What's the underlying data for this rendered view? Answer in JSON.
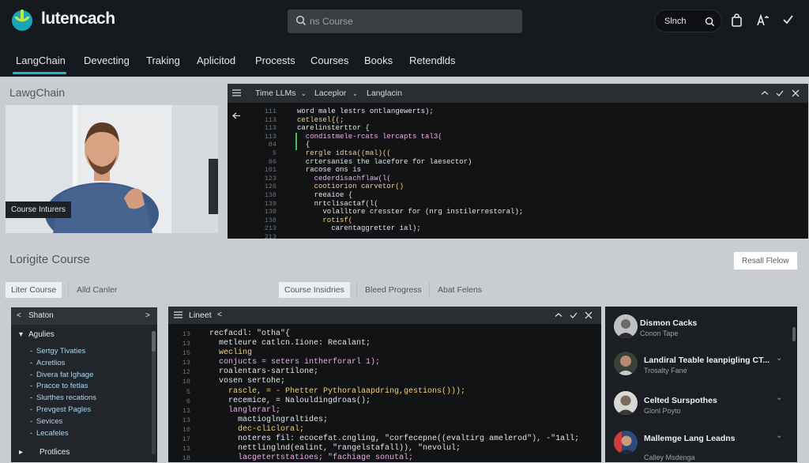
{
  "app": {
    "name": "lutencach"
  },
  "search": {
    "placeholder": "ns Course"
  },
  "header": {
    "signin_label": "Slnch"
  },
  "nav": {
    "items": [
      "LangChain",
      "Devecting",
      "Traking",
      "Aplicitod",
      "Procests",
      "Courses",
      "Books",
      "Retendlds"
    ],
    "active": 0
  },
  "hero": {
    "title": "LawgChain",
    "video_caption": "Course Inturers"
  },
  "editor1": {
    "tabs": [
      "Time LLMs",
      "Laceplor",
      "Langlacin"
    ],
    "line_numbers": [
      "111",
      "113",
      "113",
      "113",
      "84",
      "5",
      "86",
      "101",
      "123",
      "126",
      "138",
      "139",
      "130",
      "138",
      "213",
      "213"
    ],
    "lines": [
      "word male lestrs ontlangewerts);",
      "cetlesel{(;",
      "carelinsterttor {",
      "  condistmele-rcats lercapts tal3(",
      "  {",
      "  rergle idtsa((mal)((",
      "  crtersanies the lacefore for laesector)",
      "  racose ons is",
      "    cederdisachflaw(l(",
      "    cootiorion carvetor()",
      "    reeaioe {",
      "    nrtclisactaf(l(",
      "      volalltore cresster for (nrg instilerrestoral);",
      "      rotisf(",
      "        carentaggretter ial);"
    ]
  },
  "course": {
    "title": "Lorigite Course",
    "reset_label": "Resall Flelow"
  },
  "tabs_left": [
    "Liter Course",
    "Alld Canler"
  ],
  "tabs_right": [
    "Course Insidries",
    "Bleed Progress",
    "Abat Felens"
  ],
  "sidebar": {
    "header": "Shaton",
    "group1": "Agulies",
    "items": [
      "Sertgy Tivaties",
      "Acretlios",
      "Divera fat Ighage",
      "Pracce to fetlas",
      "Slurthes recations",
      "Prevgest Pagles",
      "Sevices",
      "Lecafeles"
    ],
    "group2": "Protlices"
  },
  "editor2": {
    "title": "Lineet",
    "line_numbers": [
      "13",
      "13",
      "15",
      "13",
      "12",
      "18",
      "5",
      "6",
      "13",
      "13",
      "10",
      "17",
      "13",
      "18"
    ],
    "lines": [
      "  recfacdl: \"otha\"{",
      "    metleure catlcn.Iione: Recalant;",
      "    wecling",
      "    conjucts = seters intherforarl 1);",
      "    roalentars-sartilone;",
      "    vosen sertohe;",
      "      rascle, = - Phetter Pythoralaapdring,gestions()));",
      "      recemice, = Nalouldingdroas();",
      "      langlerarl;",
      "        mactioglngraltides;",
      "        dec-clicloral;",
      "        noteres fil: ecocefat.cngling, \"corfecepne((evaltirg amelerod\"), -\"1all;",
      "        nettlinglnd(ealint, \"rangelstafall)), \"nevolul;",
      "        lacgetertstatioes; \"fachiage sonutal;"
    ]
  },
  "right_panel": {
    "items": [
      {
        "title": "Dismon Cacks",
        "subtitle": "Conon Tape"
      },
      {
        "title": "Landiral Teable leanpigling CT...",
        "subtitle": "Trosalty Fane"
      },
      {
        "title": "Celted Surspothes",
        "subtitle": "Glonl Poyto"
      },
      {
        "title": "Mallemge Lang Leadns",
        "subtitle": "Calley Msdenga"
      }
    ]
  },
  "colors": {
    "accent": "#22b6c8",
    "bg_dark": "#16191d",
    "code_bg": "#111315"
  }
}
